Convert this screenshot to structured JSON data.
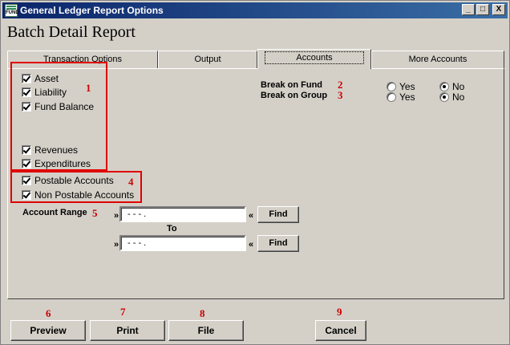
{
  "window": {
    "title": "General Ledger Report Options",
    "icon_label": "FUND",
    "controls": {
      "minimize": "_",
      "maximize": "□",
      "close": "X"
    }
  },
  "report_title": "Batch Detail Report",
  "tabs": [
    {
      "label": "Transaction Options",
      "active": false
    },
    {
      "label": "Output",
      "active": false
    },
    {
      "label": "Accounts",
      "active": true
    },
    {
      "label": "More Accounts",
      "active": false
    }
  ],
  "account_types": [
    {
      "label": "Asset",
      "checked": true
    },
    {
      "label": "Liability",
      "checked": true
    },
    {
      "label": "Fund Balance",
      "checked": true
    },
    {
      "label": "Revenues",
      "checked": true
    },
    {
      "label": "Expenditures",
      "checked": true
    }
  ],
  "postable": [
    {
      "label": "Postable Accounts",
      "checked": true
    },
    {
      "label": "Non Postable Accounts",
      "checked": true
    }
  ],
  "break_on_fund": {
    "label": "Break on Fund",
    "yes": "Yes",
    "no": "No",
    "selected": "No"
  },
  "break_on_group": {
    "label": "Break on Group",
    "yes": "Yes",
    "no": "No",
    "selected": "No"
  },
  "account_range": {
    "label": "Account Range",
    "from_value": "-  -   -  .",
    "to_label": "To",
    "to_value": "-  -   -  .",
    "left_marker": "»",
    "right_marker": "«",
    "find_label": "Find"
  },
  "buttons": {
    "preview": "Preview",
    "print": "Print",
    "file": "File",
    "cancel": "Cancel"
  },
  "annotations": [
    "1",
    "2",
    "3",
    "4",
    "5",
    "6",
    "7",
    "8",
    "9"
  ],
  "colors": {
    "annotation": "#e00000",
    "titlebar": "#0a246a",
    "face": "#d4d0c8"
  }
}
